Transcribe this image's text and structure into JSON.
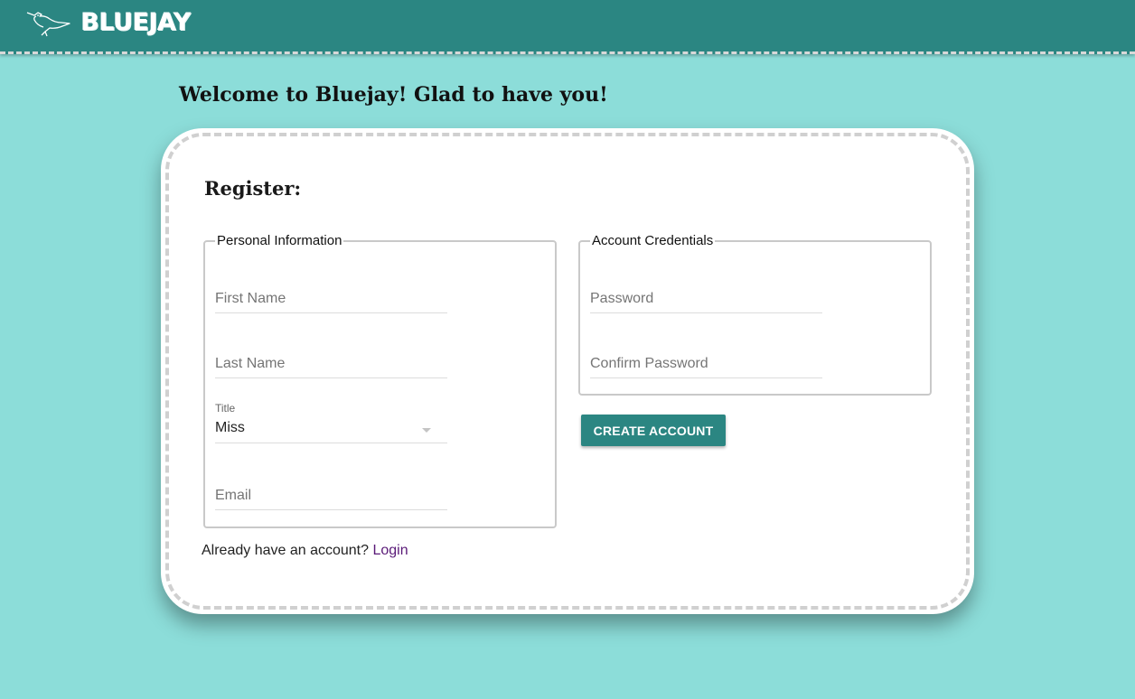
{
  "header": {
    "logo_icon": "bluejay-bird-icon",
    "brand": "BLUEJAY",
    "bar_color": "#2b8682"
  },
  "page": {
    "welcome": "Welcome to Bluejay! Glad to have you!",
    "background_color": "#8cddd9"
  },
  "form": {
    "title": "Register:",
    "personal": {
      "legend": "Personal Information",
      "first_name": {
        "placeholder": "First Name",
        "value": ""
      },
      "last_name": {
        "placeholder": "Last Name",
        "value": ""
      },
      "title_select": {
        "label": "Title",
        "value": "Miss"
      },
      "email": {
        "placeholder": "Email",
        "value": ""
      }
    },
    "account": {
      "legend": "Account Credentials",
      "password": {
        "placeholder": "Password",
        "value": ""
      },
      "confirm_password": {
        "placeholder": "Confirm Password",
        "value": ""
      }
    },
    "submit_label": "CREATE ACCOUNT",
    "already_text": "Already have an account?",
    "login_link": "Login"
  }
}
